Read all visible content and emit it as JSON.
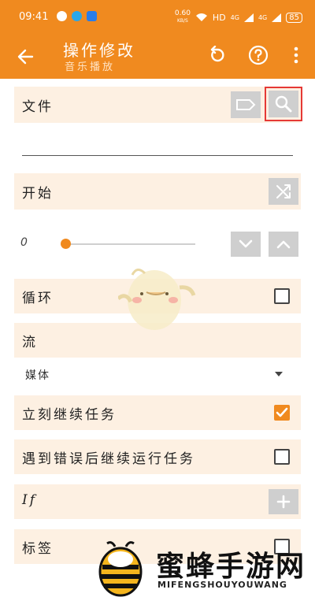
{
  "status_bar": {
    "time": "09:41",
    "net_speed_top": "0.60",
    "net_speed_bottom": "KB/S",
    "hd": "HD",
    "signal1": "4G",
    "signal2": "4G",
    "battery": "85"
  },
  "toolbar": {
    "title": "操作修改",
    "subtitle": "音乐播放"
  },
  "form": {
    "file_label": "文件",
    "start_label": "开始",
    "slider_value": "0",
    "slider_fraction": 0.03,
    "loop_label": "循环",
    "loop_checked": false,
    "stream_label": "流",
    "stream_value": "媒体",
    "continue_label": "立刻继续任务",
    "continue_checked": true,
    "error_label": "遇到错误后继续运行任务",
    "error_checked": false,
    "if_label": "If",
    "tag_label": "标签",
    "tag_checked": false
  },
  "watermark": {
    "text": "蜜蜂手游网",
    "sub": "MIFENGSHOUYOUWANG"
  },
  "colors": {
    "accent": "#f08a1f",
    "row_bg": "#fdf0e2",
    "highlight": "#e53935"
  }
}
